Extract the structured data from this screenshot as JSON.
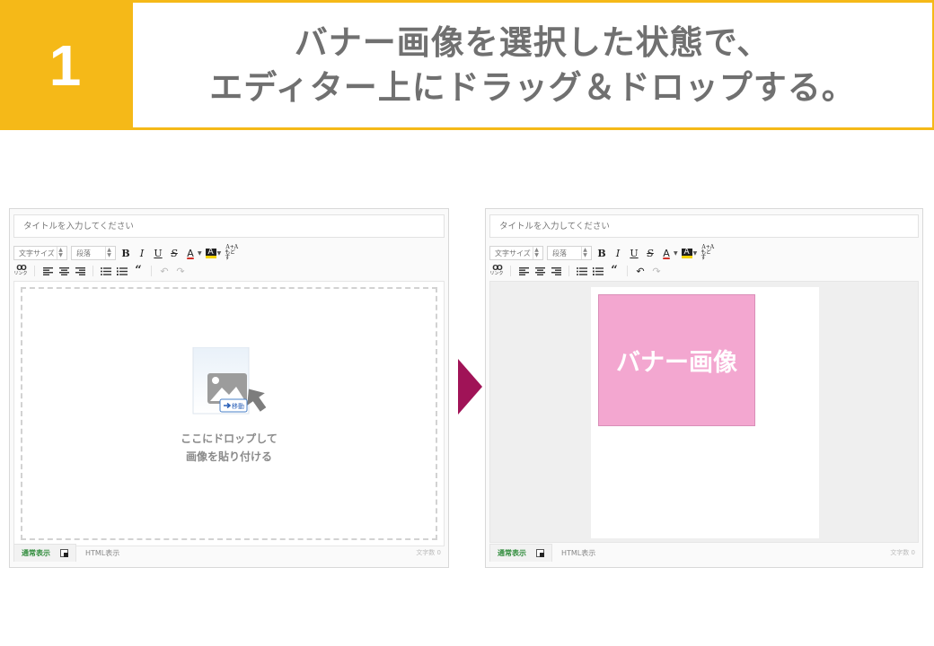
{
  "header": {
    "step_number": "1",
    "line1": "バナー画像を選択した状態で、",
    "line2": "エディター上にドラッグ＆ドロップする。"
  },
  "editor": {
    "title_placeholder": "タイトルを入力してください",
    "font_size_label": "文字サイズ",
    "paragraph_label": "段落",
    "bold": "B",
    "italic": "I",
    "underline": "U",
    "strike": "S",
    "text_color": "A",
    "highlight": "A",
    "font_size_toggle_top": "A+A",
    "font_size_toggle_bottom": "もどす",
    "link_label": "リンク",
    "quote": "“",
    "tab_normal": "通常表示",
    "tab_html": "HTML表示",
    "char_count": "文字数 0"
  },
  "left": {
    "drop_line1": "ここにドロップして",
    "drop_line2": "画像を貼り付ける",
    "move_badge": "移動"
  },
  "right": {
    "banner_text": "バナー画像",
    "banner_color": "#f3a7d0"
  },
  "colors": {
    "accent": "#f5b918",
    "arrow": "#a01357",
    "tab_active_text": "#2e8b3a"
  }
}
